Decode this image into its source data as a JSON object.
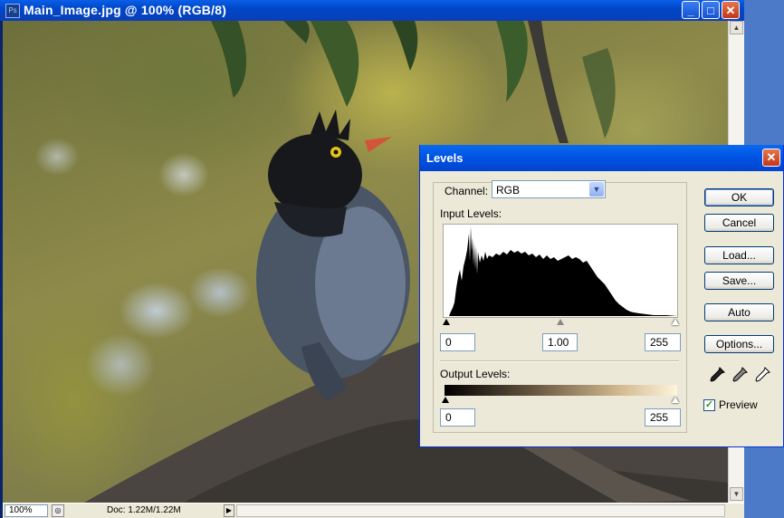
{
  "document_window": {
    "title": "Main_Image.jpg @ 100% (RGB/8)",
    "app_icon_glyph": "Ps",
    "minimize_glyph": "_",
    "maximize_glyph": "□",
    "close_glyph": "✕"
  },
  "status_bar": {
    "zoom": "100%",
    "doc_info": "Doc: 1.22M/1.22M",
    "menu_arrow_glyph": "▶"
  },
  "levels_dialog": {
    "title": "Levels",
    "close_glyph": "✕",
    "channel_label": "Channel:",
    "channel_value": "RGB",
    "dropdown_glyph": "▼",
    "input_levels_label": "Input Levels:",
    "input_black": "0",
    "input_gamma": "1.00",
    "input_white": "255",
    "output_levels_label": "Output Levels:",
    "output_black": "0",
    "output_white": "255",
    "buttons": {
      "ok": "OK",
      "cancel": "Cancel",
      "load": "Load...",
      "save": "Save...",
      "auto": "Auto",
      "options": "Options..."
    },
    "eyedroppers": [
      "black-point",
      "gray-point",
      "white-point"
    ],
    "preview_label": "Preview",
    "preview_checked": true,
    "preview_check_glyph": "✓"
  },
  "colors": {
    "titlebar_blue": "#0054e3",
    "dialog_bg": "#ece9d8",
    "close_red": "#c2361a"
  }
}
